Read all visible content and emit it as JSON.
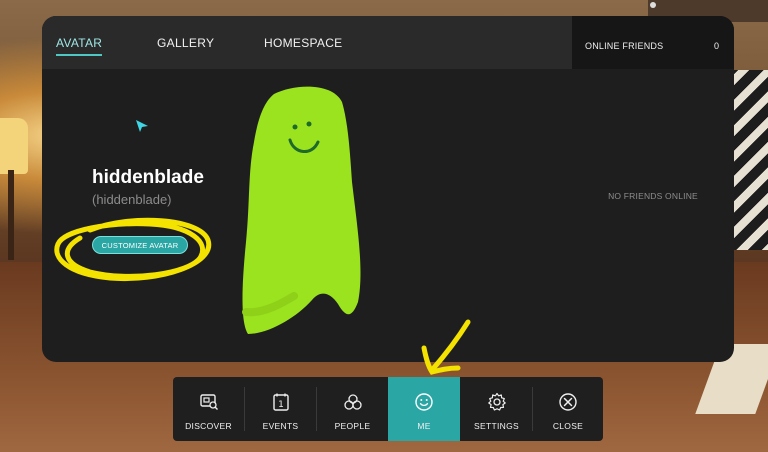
{
  "tabs": [
    {
      "label": "AVATAR",
      "active": true
    },
    {
      "label": "GALLERY",
      "active": false
    },
    {
      "label": "HOMESPACE",
      "active": false
    }
  ],
  "friends": {
    "header": "ONLINE FRIENDS",
    "count": "0",
    "empty_text": "NO FRIENDS ONLINE"
  },
  "profile": {
    "display_name": "hiddenblade",
    "username": "(hiddenblade)",
    "customize_label": "CUSTOMIZE AVATAR"
  },
  "nav": [
    {
      "label": "DISCOVER",
      "icon": "discover-icon",
      "active": false
    },
    {
      "label": "EVENTS",
      "icon": "calendar-icon",
      "active": false,
      "badge": "1"
    },
    {
      "label": "PEOPLE",
      "icon": "people-icon",
      "active": false
    },
    {
      "label": "ME",
      "icon": "smiley-icon",
      "active": true
    },
    {
      "label": "SETTINGS",
      "icon": "gear-icon",
      "active": false
    },
    {
      "label": "CLOSE",
      "icon": "close-icon",
      "active": false
    }
  ],
  "colors": {
    "accent": "#2aa6a4",
    "panel": "#1e1e1e",
    "annotation": "#f4e200",
    "avatar": "#9be31e"
  }
}
